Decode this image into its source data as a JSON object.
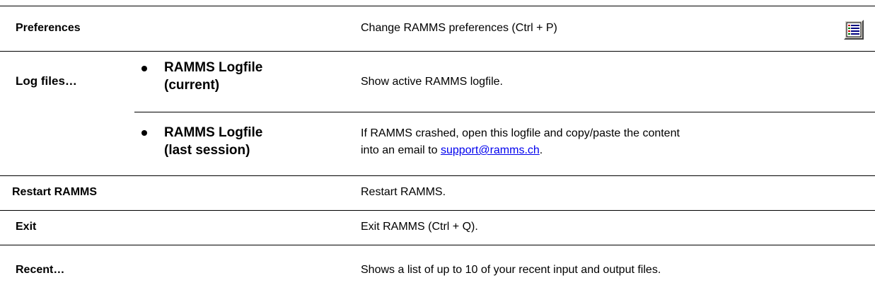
{
  "rows": [
    {
      "label": "Preferences",
      "description": "Change RAMMS preferences (Ctrl + P)",
      "icon": "preferences-icon"
    },
    {
      "label": "Log files…",
      "sub_items": [
        {
          "label_line1": "RAMMS Logfile",
          "label_line2": "(current)",
          "description": "Show active RAMMS logfile."
        },
        {
          "label_line1": "RAMMS Logfile",
          "label_line2": "(last session)",
          "description_line1": "If RAMMS crashed, open this logfile and copy/paste the content",
          "description_prefix": "into an email to ",
          "link_text": "support@ramms.ch",
          "description_suffix": "."
        }
      ]
    },
    {
      "label": "Restart RAMMS",
      "description": "Restart RAMMS."
    },
    {
      "label": "Exit",
      "description": "Exit RAMMS (Ctrl + Q)."
    },
    {
      "label": "Recent…",
      "description": "Shows a list of up to 10 of your recent input and output files."
    }
  ],
  "colors": {
    "rule": "#000000",
    "link": "#0000ee"
  }
}
